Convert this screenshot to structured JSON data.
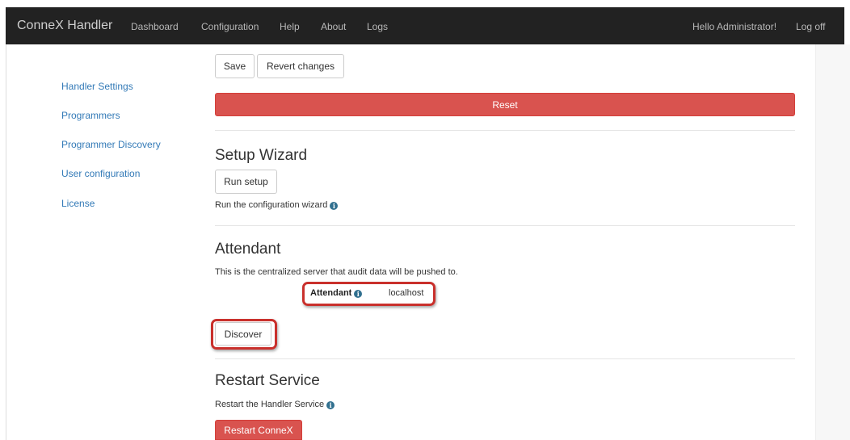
{
  "navbar": {
    "brand": "ConneX Handler",
    "links": [
      "Dashboard",
      "Configuration",
      "Help",
      "About",
      "Logs"
    ],
    "greeting": "Hello Administrator!",
    "logoff": "Log off"
  },
  "sidebar": {
    "items": [
      "Handler Settings",
      "Programmers",
      "Programmer Discovery",
      "User configuration",
      "License"
    ]
  },
  "toolbar": {
    "save_label": "Save",
    "revert_label": "Revert changes",
    "reset_label": "Reset"
  },
  "setup": {
    "title": "Setup Wizard",
    "button": "Run setup",
    "help": "Run the configuration wizard"
  },
  "attendant": {
    "title": "Attendant",
    "description": "This is the centralized server that audit data will be pushed to.",
    "label": "Attendant",
    "value": "localhost",
    "discover_label": "Discover"
  },
  "restart": {
    "title": "Restart Service",
    "help": "Restart the Handler Service",
    "button": "Restart ConneX"
  },
  "colors": {
    "danger": "#d9534f",
    "link": "#337ab7",
    "navbar": "#222222",
    "highlight": "#c9302c"
  }
}
